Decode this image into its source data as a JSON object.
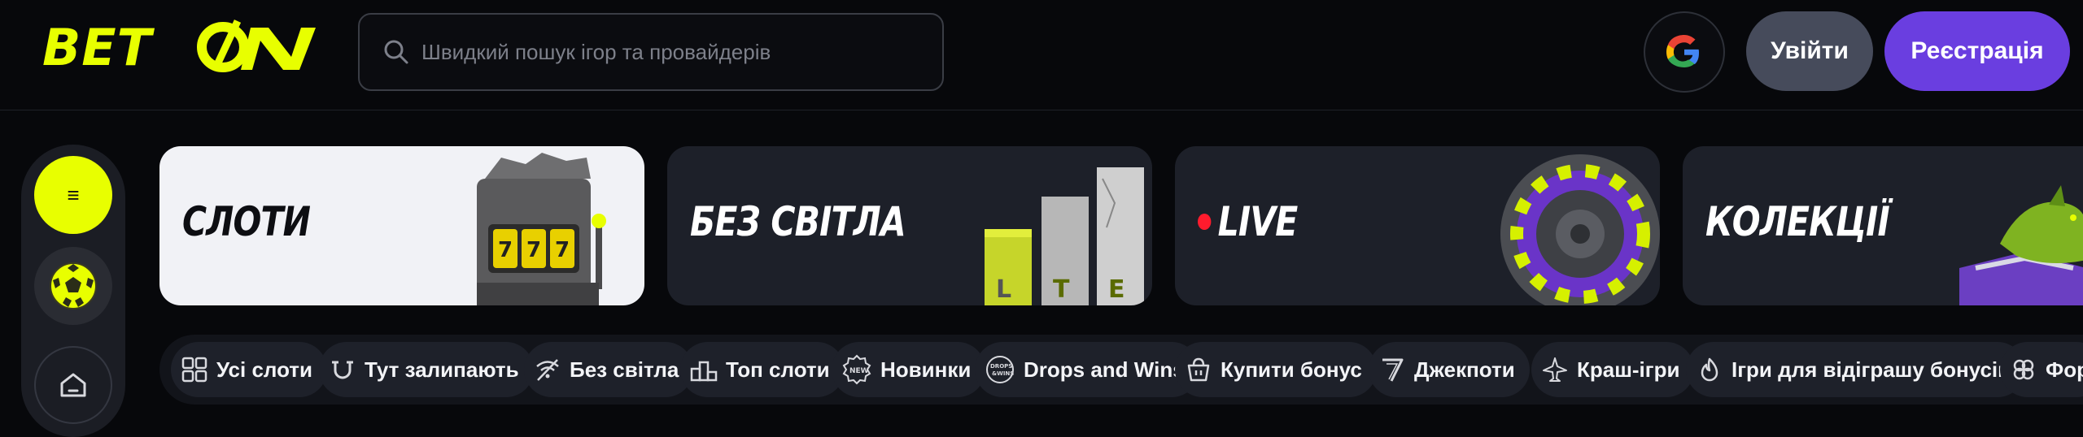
{
  "header": {
    "logo_text": "BETON",
    "search": {
      "placeholder": "Швидкий пошук ігор та провайдерів"
    },
    "google_label": "google-icon",
    "login_label": "Увійти",
    "register_label": "Реєстрація"
  },
  "sidebar": {
    "menu_icon": "≡",
    "items": [
      {
        "name": "menu",
        "icon": "menu-icon"
      },
      {
        "name": "sport",
        "icon": "soccer-ball-icon"
      },
      {
        "name": "home",
        "icon": "home-icon"
      }
    ]
  },
  "categories": [
    {
      "label": "СЛОТИ",
      "theme": "light"
    },
    {
      "label": "БЕЗ СВІТЛА",
      "theme": "dark"
    },
    {
      "label": "LIVE",
      "theme": "dark",
      "live": true
    },
    {
      "label": "КОЛЕКЦІЇ",
      "theme": "dark"
    }
  ],
  "chips": [
    {
      "label": "Усі слоти",
      "icon": "grid-icon"
    },
    {
      "label": "Тут залипають",
      "icon": "magnet-icon"
    },
    {
      "label": "Без світла",
      "icon": "no-wifi-icon"
    },
    {
      "label": "Топ слоти",
      "icon": "podium-icon"
    },
    {
      "label": "Новинки",
      "icon": "new-badge-icon"
    },
    {
      "label": "Drops and Wins",
      "icon": "drops-badge-icon"
    },
    {
      "label": "Купити бонус",
      "icon": "basket-icon"
    },
    {
      "label": "Джекпоти",
      "icon": "seven-icon"
    },
    {
      "label": "Краш-ігри",
      "icon": "plane-icon"
    },
    {
      "label": "Ігри для відіграшу бонусів",
      "icon": "flame-icon"
    },
    {
      "label": "Фор",
      "icon": "clover-icon"
    }
  ],
  "colors": {
    "accent": "#e8ff00",
    "register": "#6a3ee0",
    "login": "#464b5b",
    "live_dot": "#ff1b2d",
    "background": "#07080b"
  }
}
